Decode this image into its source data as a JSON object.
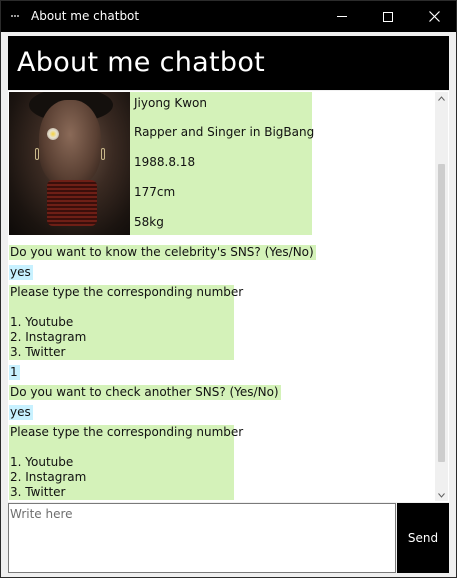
{
  "window": {
    "title": "About me chatbot",
    "controls": {
      "minimize": "minimize-icon",
      "maximize": "maximize-icon",
      "close": "close-icon"
    }
  },
  "header": {
    "title": "About me chatbot"
  },
  "profile": {
    "photo_alt": "celebrity photo",
    "lines": [
      "Jiyong Kwon",
      "Rapper and Singer in BigBang",
      "1988.8.18",
      "177cm",
      "58kg"
    ]
  },
  "messages": [
    {
      "sender": "bot",
      "text": "Do you want to know the celebrity's SNS? (Yes/No)"
    },
    {
      "sender": "user",
      "text": "yes"
    },
    {
      "sender": "bot",
      "text": "Please type the corresponding number\n\n1. Youtube\n2. Instagram\n3. Twitter"
    },
    {
      "sender": "user",
      "text": "1"
    },
    {
      "sender": "bot",
      "text": "Do you want to check another SNS? (Yes/No)"
    },
    {
      "sender": "user",
      "text": "yes"
    },
    {
      "sender": "bot",
      "text": "Please type the corresponding number\n\n1. Youtube\n2. Instagram\n3. Twitter"
    }
  ],
  "input": {
    "placeholder": "Write here",
    "value": ""
  },
  "send": {
    "label": "Send"
  },
  "colors": {
    "bot_bubble": "#d4f2b9",
    "user_bubble": "#c8f1ff",
    "header_bg": "#000000"
  }
}
